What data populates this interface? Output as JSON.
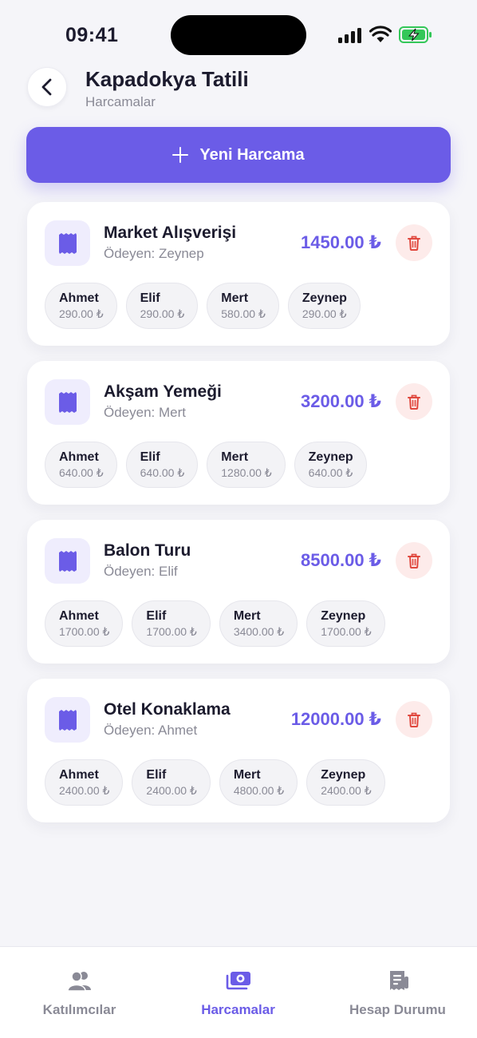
{
  "status": {
    "time": "09:41"
  },
  "header": {
    "title": "Kapadokya Tatili",
    "subtitle": "Harcamalar"
  },
  "actions": {
    "new_expense_label": "Yeni Harcama"
  },
  "expenses": [
    {
      "title": "Market Alışverişi",
      "payer": "Ödeyen: Zeynep",
      "amount": "1450.00 ₺",
      "shares": [
        {
          "name": "Ahmet",
          "amount": "290.00 ₺"
        },
        {
          "name": "Elif",
          "amount": "290.00 ₺"
        },
        {
          "name": "Mert",
          "amount": "580.00 ₺"
        },
        {
          "name": "Zeynep",
          "amount": "290.00 ₺"
        }
      ]
    },
    {
      "title": "Akşam Yemeği",
      "payer": "Ödeyen: Mert",
      "amount": "3200.00 ₺",
      "shares": [
        {
          "name": "Ahmet",
          "amount": "640.00 ₺"
        },
        {
          "name": "Elif",
          "amount": "640.00 ₺"
        },
        {
          "name": "Mert",
          "amount": "1280.00 ₺"
        },
        {
          "name": "Zeynep",
          "amount": "640.00 ₺"
        }
      ]
    },
    {
      "title": "Balon Turu",
      "payer": "Ödeyen: Elif",
      "amount": "8500.00 ₺",
      "shares": [
        {
          "name": "Ahmet",
          "amount": "1700.00 ₺"
        },
        {
          "name": "Elif",
          "amount": "1700.00 ₺"
        },
        {
          "name": "Mert",
          "amount": "3400.00 ₺"
        },
        {
          "name": "Zeynep",
          "amount": "1700.00 ₺"
        }
      ]
    },
    {
      "title": "Otel Konaklama",
      "payer": "Ödeyen: Ahmet",
      "amount": "12000.00 ₺",
      "shares": [
        {
          "name": "Ahmet",
          "amount": "2400.00 ₺"
        },
        {
          "name": "Elif",
          "amount": "2400.00 ₺"
        },
        {
          "name": "Mert",
          "amount": "4800.00 ₺"
        },
        {
          "name": "Zeynep",
          "amount": "2400.00 ₺"
        }
      ]
    }
  ],
  "tabs": [
    {
      "label": "Katılımcılar",
      "icon": "users-icon",
      "active": false
    },
    {
      "label": "Harcamalar",
      "icon": "money-icon",
      "active": true
    },
    {
      "label": "Hesap Durumu",
      "icon": "report-icon",
      "active": false
    }
  ],
  "colors": {
    "accent": "#6b5ce7",
    "accent_soft": "#efedfd",
    "danger": "#e0483e",
    "danger_soft": "#fdebea",
    "muted": "#8a8a96",
    "background": "#f5f5f9"
  }
}
